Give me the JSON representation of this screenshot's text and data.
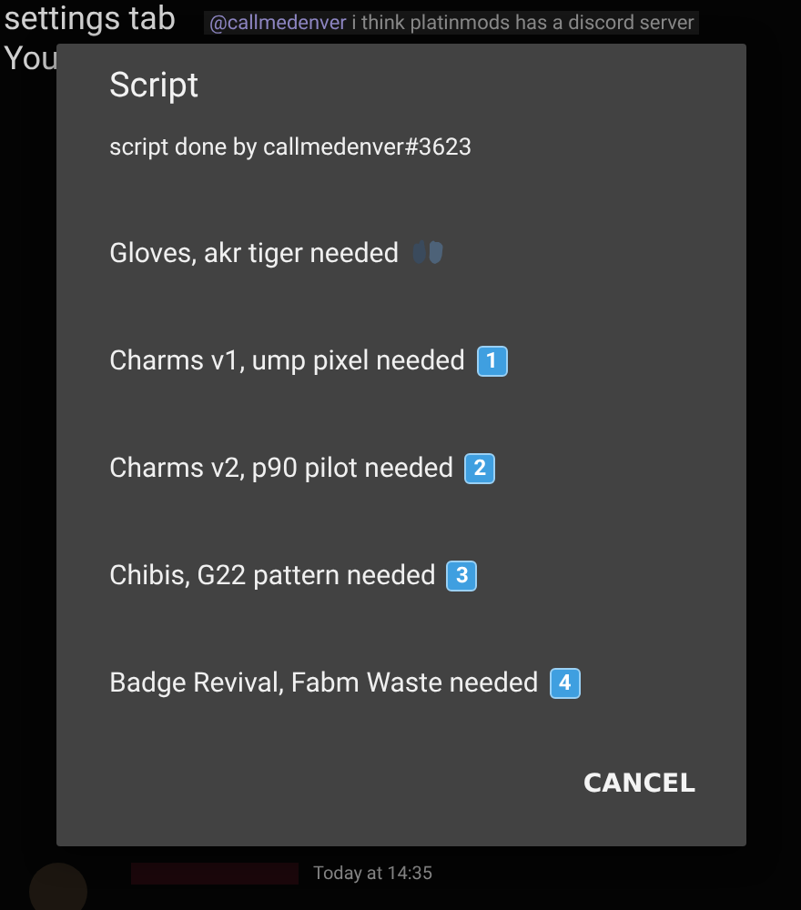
{
  "background_chat": {
    "lines": [
      "settings tab",
      "You"
    ],
    "mention": {
      "user": "@callmedenver",
      "text": "i think platinmods has a discord server"
    },
    "footer_message": {
      "time": "Today at 14:35"
    }
  },
  "dialog": {
    "title": "Script",
    "subtitle": "script done by callmedenver#3623",
    "items": [
      {
        "kind": "gloves",
        "text": "Gloves, akr tiger needed"
      },
      {
        "kind": "keycap",
        "text": "Charms v1, ump pixel needed",
        "badge": "1"
      },
      {
        "kind": "keycap",
        "text": "Charms v2, p90 pilot needed",
        "badge": "2"
      },
      {
        "kind": "keycap",
        "text": "Chibis, G22 pattern needed",
        "badge": "3"
      },
      {
        "kind": "keycap",
        "text": "Badge Revival, Fabm Waste needed",
        "badge": "4"
      }
    ],
    "buttons": [
      "CANCEL"
    ]
  }
}
